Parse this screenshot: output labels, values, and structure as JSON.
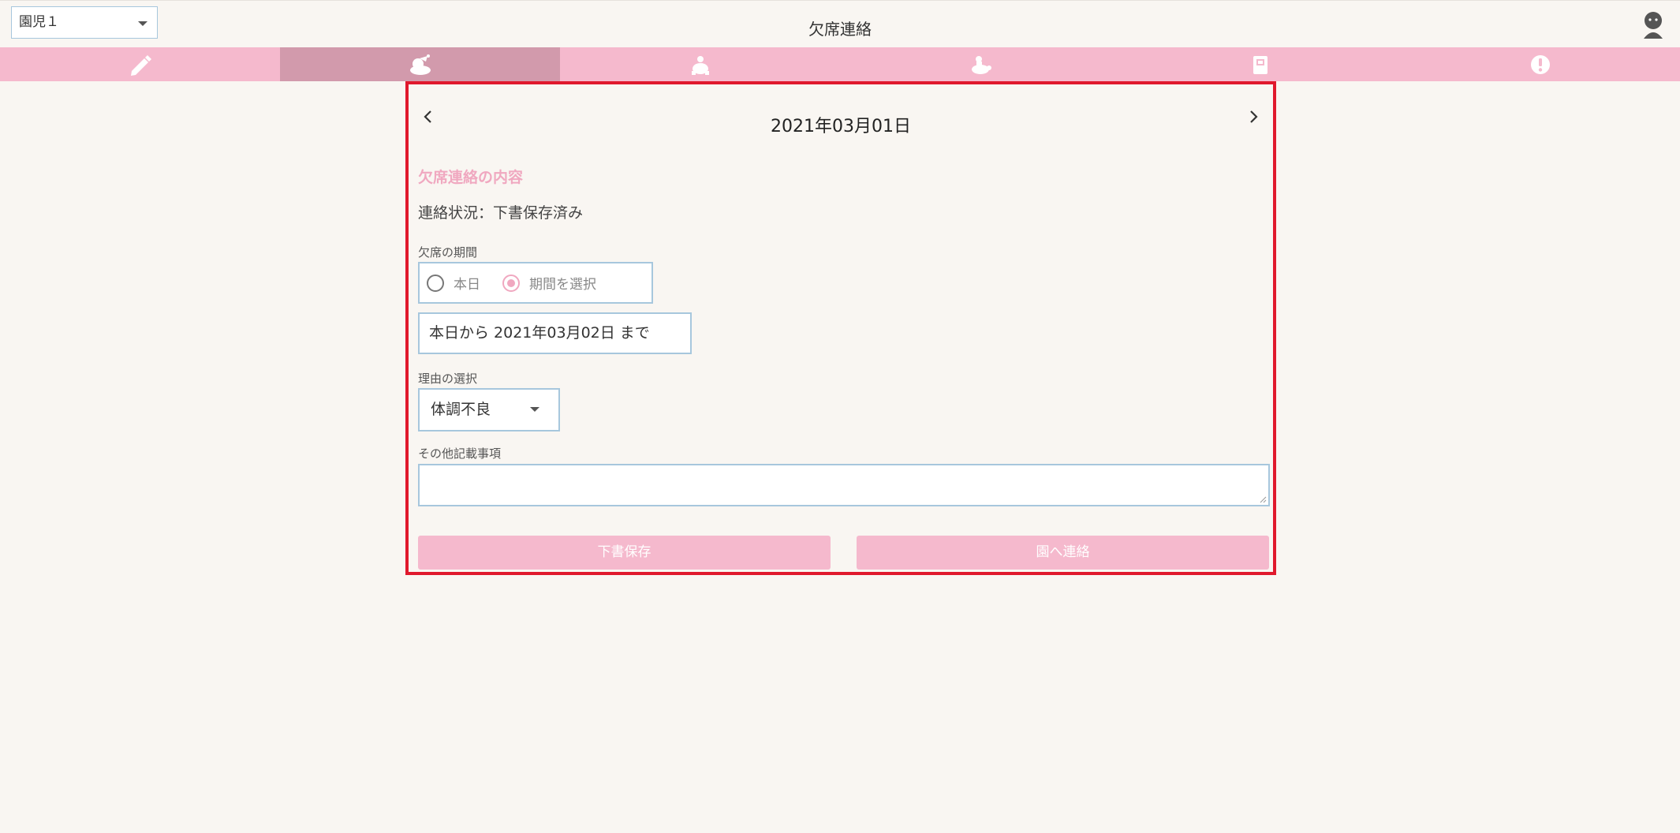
{
  "header": {
    "child_select": "園児１",
    "title": "欠席連絡"
  },
  "tabs": [
    {
      "icon": "pencil-icon",
      "active": false
    },
    {
      "icon": "sleeping-child-icon",
      "active": true
    },
    {
      "icon": "turtle-icon",
      "active": false
    },
    {
      "icon": "turtle-rider-icon",
      "active": false
    },
    {
      "icon": "calendar-icon",
      "active": false
    },
    {
      "icon": "alert-icon",
      "active": false
    }
  ],
  "panel": {
    "date": "2021年03月01日",
    "section_title": "欠席連絡の内容",
    "status": "連絡状況：下書保存済み",
    "period_label": "欠席の期間",
    "radio_today": "本日",
    "radio_range": "期間を選択",
    "range_value": "本日から  2021年03月02日  まで",
    "reason_label": "理由の選択",
    "reason_value": "体調不良",
    "notes_label": "その他記載事項",
    "notes_value": "",
    "draft_button": "下書保存",
    "send_button": "園へ連絡"
  },
  "colors": {
    "tabbar": "#f5b9cd",
    "tab_active": "#d29aac",
    "highlight_border": "#e0192d",
    "accent_pink": "#f0a8c0",
    "field_border": "#a7c7dd",
    "background": "#f9f6f2"
  }
}
